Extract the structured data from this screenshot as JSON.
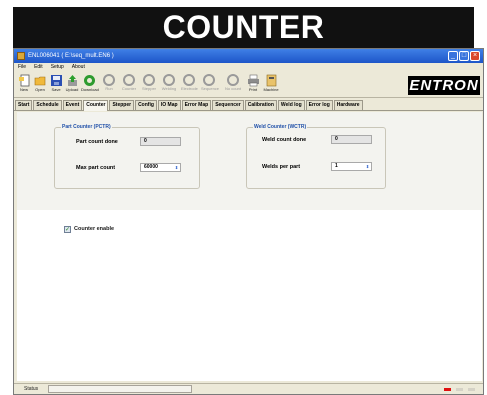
{
  "banner": {
    "title": "COUNTER"
  },
  "window": {
    "title": "ENL006041 ( E:\\seq_mult.EN6 )",
    "controls": {
      "minimize": "_",
      "maximize": "□",
      "close": "×"
    }
  },
  "menu": {
    "items": [
      "File",
      "Edit",
      "Setup",
      "About"
    ]
  },
  "toolbar": {
    "items": [
      {
        "label": "New",
        "icon": "new-doc-icon",
        "enabled": true
      },
      {
        "label": "Open",
        "icon": "folder-open-icon",
        "enabled": true
      },
      {
        "label": "Save",
        "icon": "floppy-disk-icon",
        "enabled": true
      },
      {
        "label": "Upload",
        "icon": "upload-icon",
        "enabled": true
      },
      {
        "label": "Download",
        "icon": "download-icon",
        "enabled": true
      },
      {
        "label": "Run",
        "icon": "circle-icon",
        "enabled": false
      },
      {
        "label": "Counter",
        "icon": "circle-icon",
        "enabled": false
      },
      {
        "label": "Stepper",
        "icon": "circle-icon",
        "enabled": false
      },
      {
        "label": "Welding",
        "icon": "circle-icon",
        "enabled": false
      },
      {
        "label": "Electrode",
        "icon": "circle-icon",
        "enabled": false
      },
      {
        "label": "Sequence",
        "icon": "circle-icon",
        "enabled": false
      },
      {
        "label": "No count",
        "icon": "circle-icon",
        "enabled": false
      },
      {
        "label": "Print",
        "icon": "printer-icon",
        "enabled": true
      },
      {
        "label": "Machine",
        "icon": "machine-icon",
        "enabled": true
      }
    ]
  },
  "brand": {
    "logo_text": "ENTRON"
  },
  "tabs": [
    {
      "label": "Start",
      "active": false
    },
    {
      "label": "Schedule",
      "active": false
    },
    {
      "label": "Event",
      "active": false
    },
    {
      "label": "Counter",
      "active": true
    },
    {
      "label": "Stepper",
      "active": false
    },
    {
      "label": "Config",
      "active": false
    },
    {
      "label": "IO Map",
      "active": false
    },
    {
      "label": "Error Map",
      "active": false
    },
    {
      "label": "Sequencer",
      "active": false
    },
    {
      "label": "Calibration",
      "active": false
    },
    {
      "label": "Weld log",
      "active": false
    },
    {
      "label": "Error log",
      "active": false
    },
    {
      "label": "Hardware",
      "active": false
    }
  ],
  "part_counter": {
    "title": "Part Counter (PCTR)",
    "count_done_label": "Part count done",
    "count_done_value": "0",
    "max_count_label": "Max part count",
    "max_count_value": "60000"
  },
  "weld_counter": {
    "title": "Weld Counter (WCTR)",
    "count_done_label": "Weld count done",
    "count_done_value": "0",
    "welds_per_part_label": "Welds per part",
    "welds_per_part_value": "1"
  },
  "counter_enable": {
    "label": "Counter enable",
    "checked": true
  },
  "status": {
    "label": "Status",
    "text": ""
  },
  "colors": {
    "accent": "#1f4fa8",
    "titlebar": "#2a63d6",
    "status_red": "#e01010"
  }
}
